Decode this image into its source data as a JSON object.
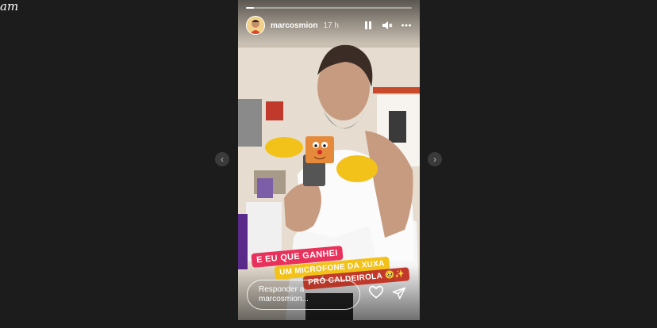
{
  "app": {
    "logo_text": "am"
  },
  "story": {
    "username": "marcosmion",
    "time": "17 h",
    "progress": 0.05,
    "stickers": [
      "E EU QUE GANHEI",
      "UM MICROFONE DA XUXA",
      "PRÓ CALDEIROLA 🥹✨"
    ],
    "reply_placeholder_line1": "Responder a",
    "reply_placeholder_line2": "marcosmion...",
    "icons": {
      "pause": "pause-icon",
      "mute": "speaker-muted-icon",
      "more": "more-options-icon",
      "like": "heart-icon",
      "share": "paper-plane-icon"
    }
  },
  "colors": {
    "page_bg": "#1c1c1c",
    "tag_red": "#e8315b",
    "tag_yellow": "#f2c21b"
  }
}
